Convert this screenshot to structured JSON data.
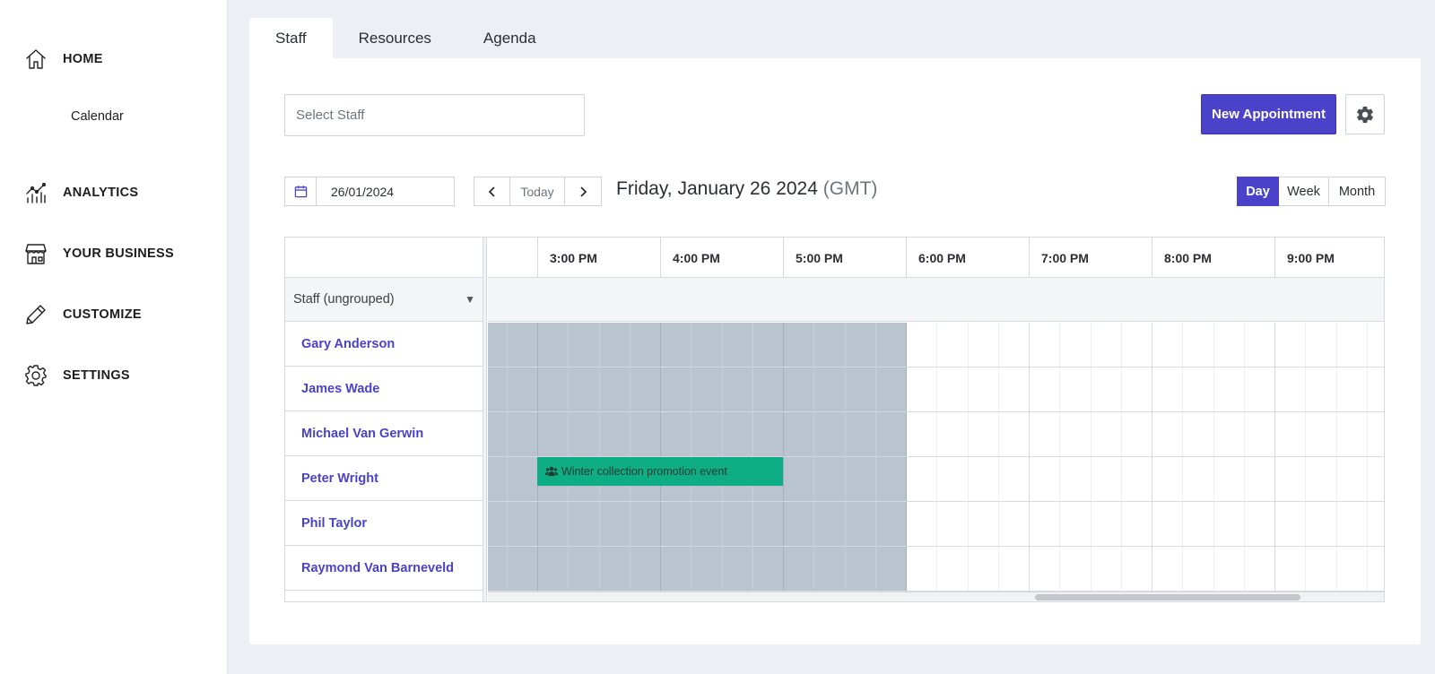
{
  "sidebar": {
    "items": [
      {
        "label": "HOME",
        "icon": "home-icon"
      },
      {
        "label": "ANALYTICS",
        "icon": "analytics-icon"
      },
      {
        "label": "YOUR BUSINESS",
        "icon": "store-icon"
      },
      {
        "label": "CUSTOMIZE",
        "icon": "pencil-icon"
      },
      {
        "label": "SETTINGS",
        "icon": "gear-icon"
      }
    ],
    "sub_item": "Calendar"
  },
  "tabs": [
    {
      "label": "Staff",
      "active": true
    },
    {
      "label": "Resources",
      "active": false
    },
    {
      "label": "Agenda",
      "active": false
    }
  ],
  "toolbar": {
    "select_staff_placeholder": "Select Staff",
    "new_appointment_label": "New Appointment"
  },
  "date_nav": {
    "date_value": "26/01/2024",
    "prev": "‹",
    "today_label": "Today",
    "next": "›",
    "title": "Friday, January 26 2024",
    "timezone": "(GMT)"
  },
  "views": [
    {
      "label": "Day",
      "active": true
    },
    {
      "label": "Week",
      "active": false
    },
    {
      "label": "Month",
      "active": false
    }
  ],
  "scheduler": {
    "group_label": "Staff (ungrouped)",
    "group_caret": "▼",
    "times": [
      "3:00 PM",
      "4:00 PM",
      "5:00 PM",
      "6:00 PM",
      "7:00 PM",
      "8:00 PM",
      "9:00 PM"
    ],
    "staff": [
      "Gary Anderson",
      "James Wade",
      "Michael Van Gerwin",
      "Peter Wright",
      "Phil Taylor",
      "Raymond Van Barneveld"
    ],
    "event": {
      "title": "Winter collection promotion event",
      "staff": "Peter Wright",
      "start": "3:00 PM",
      "end": "5:00 PM"
    }
  },
  "colors": {
    "accent": "#4a42c9",
    "event": "#0ead84",
    "unavailable": "#b9c4cf"
  }
}
